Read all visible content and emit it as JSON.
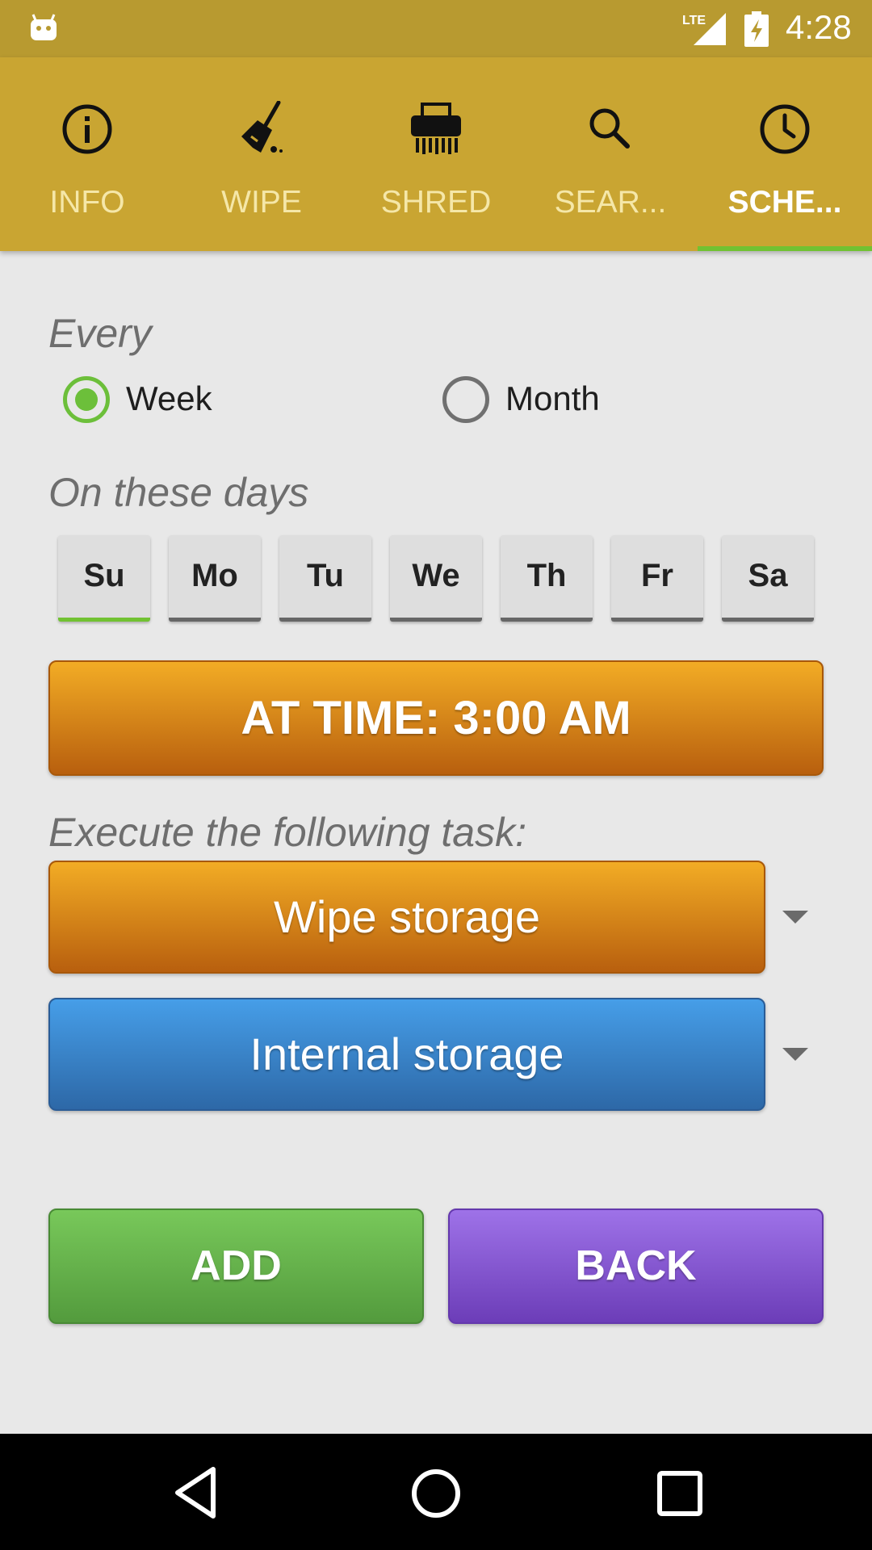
{
  "status_bar": {
    "network": "LTE",
    "time": "4:28"
  },
  "tabs": [
    {
      "label": "INFO",
      "icon": "info-icon"
    },
    {
      "label": "WIPE",
      "icon": "broom-icon"
    },
    {
      "label": "SHRED",
      "icon": "shredder-icon"
    },
    {
      "label": "SEAR...",
      "icon": "search-icon"
    },
    {
      "label": "SCHE...",
      "icon": "clock-icon",
      "active": true
    }
  ],
  "schedule": {
    "every_label": "Every",
    "frequency_options": [
      "Week",
      "Month"
    ],
    "selected_frequency": "Week",
    "days_label": "On these days",
    "days": [
      "Su",
      "Mo",
      "Tu",
      "We",
      "Th",
      "Fr",
      "Sa"
    ],
    "selected_days": [
      "Su"
    ],
    "time_button": "AT TIME: 3:00 AM",
    "task_label": "Execute the following task:",
    "task_select": "Wipe storage",
    "storage_select": "Internal storage",
    "add_button": "ADD",
    "back_button": "BACK"
  },
  "colors": {
    "status_bar": "#b89a30",
    "tab_bar": "#c9a532",
    "tab_indicator": "#71c232",
    "radio_checked": "#6cbf3a",
    "time_button": "#e08a1a",
    "storage_button": "#3a82cc",
    "add_button": "#66b24a",
    "back_button": "#8656d0"
  }
}
